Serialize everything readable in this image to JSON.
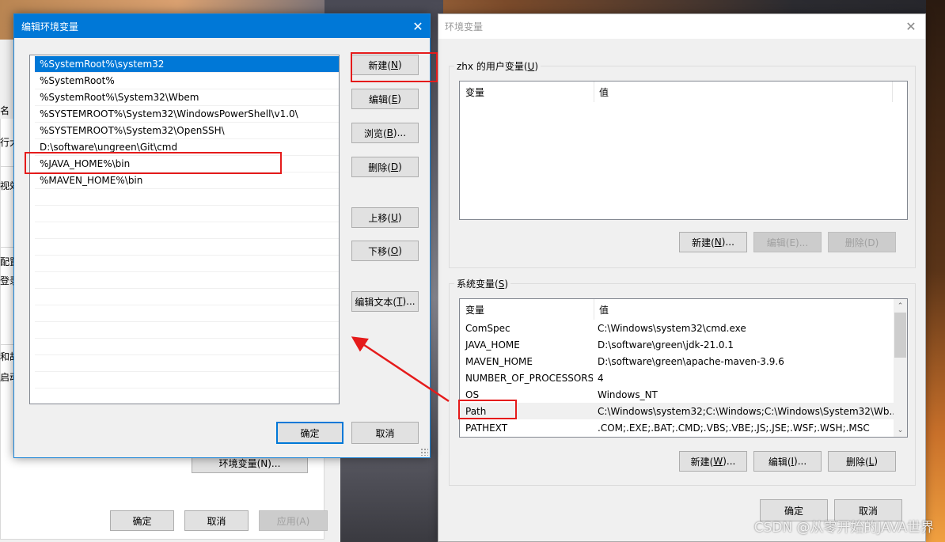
{
  "background_window": {
    "table_header_fragment": "名",
    "text_fragments": [
      "行大",
      "视效",
      "配置",
      "登录",
      "和故",
      "启动"
    ],
    "env_vars_button": "环境变量(N)...",
    "ok": "确定",
    "cancel": "取消",
    "apply": "应用(A)"
  },
  "edit_dialog": {
    "title": "编辑环境变量",
    "entries": [
      "%SystemRoot%\\system32",
      "%SystemRoot%",
      "%SystemRoot%\\System32\\Wbem",
      "%SYSTEMROOT%\\System32\\WindowsPowerShell\\v1.0\\",
      "%SYSTEMROOT%\\System32\\OpenSSH\\",
      "D:\\software\\ungreen\\Git\\cmd",
      "%JAVA_HOME%\\bin",
      "%MAVEN_HOME%\\bin"
    ],
    "selected_index": 0,
    "buttons": {
      "new": {
        "text": "新建(",
        "key": "N",
        "tail": ")"
      },
      "edit": {
        "text": "编辑(",
        "key": "E",
        "tail": ")"
      },
      "browse": {
        "text": "浏览(",
        "key": "B",
        "tail": ")..."
      },
      "delete": {
        "text": "删除(",
        "key": "D",
        "tail": ")"
      },
      "move_up": {
        "text": "上移(",
        "key": "U",
        "tail": ")"
      },
      "move_down": {
        "text": "下移(",
        "key": "O",
        "tail": ")"
      },
      "edit_text": {
        "text": "编辑文本(",
        "key": "T",
        "tail": ")..."
      }
    },
    "ok": "确定",
    "cancel": "取消"
  },
  "env_dialog": {
    "title": "环境变量",
    "user_group": {
      "text": "zhx 的用户变量(",
      "key": "U",
      "tail": ")"
    },
    "columns": {
      "name": "变量",
      "value": "值"
    },
    "user_vars": [],
    "user_buttons": {
      "new": {
        "text": "新建(",
        "key": "N",
        "tail": ")..."
      },
      "edit": "编辑(E)...",
      "delete": "删除(D)"
    },
    "system_group": {
      "text": "系统变量(",
      "key": "S",
      "tail": ")"
    },
    "system_vars": [
      {
        "name": "ComSpec",
        "value": "C:\\Windows\\system32\\cmd.exe"
      },
      {
        "name": "JAVA_HOME",
        "value": "D:\\software\\green\\jdk-21.0.1"
      },
      {
        "name": "MAVEN_HOME",
        "value": "D:\\software\\green\\apache-maven-3.9.6"
      },
      {
        "name": "NUMBER_OF_PROCESSORS",
        "value": "4"
      },
      {
        "name": "OS",
        "value": "Windows_NT"
      },
      {
        "name": "Path",
        "value": "C:\\Windows\\system32;C:\\Windows;C:\\Windows\\System32\\Wb..."
      },
      {
        "name": "PATHEXT",
        "value": ".COM;.EXE;.BAT;.CMD;.VBS;.VBE;.JS;.JSE;.WSF;.WSH;.MSC"
      }
    ],
    "highlighted_index": 5,
    "system_buttons": {
      "new": {
        "text": "新建(",
        "key": "W",
        "tail": ")..."
      },
      "edit": {
        "text": "编辑(",
        "key": "I",
        "tail": ")..."
      },
      "delete": {
        "text": "删除(",
        "key": "L",
        "tail": ")"
      }
    },
    "ok": "确定",
    "cancel": "取消"
  },
  "watermark": "CSDN @从零开始的JAVA世界",
  "colors": {
    "accent": "#0078d7",
    "annotation": "#e51b1b"
  }
}
